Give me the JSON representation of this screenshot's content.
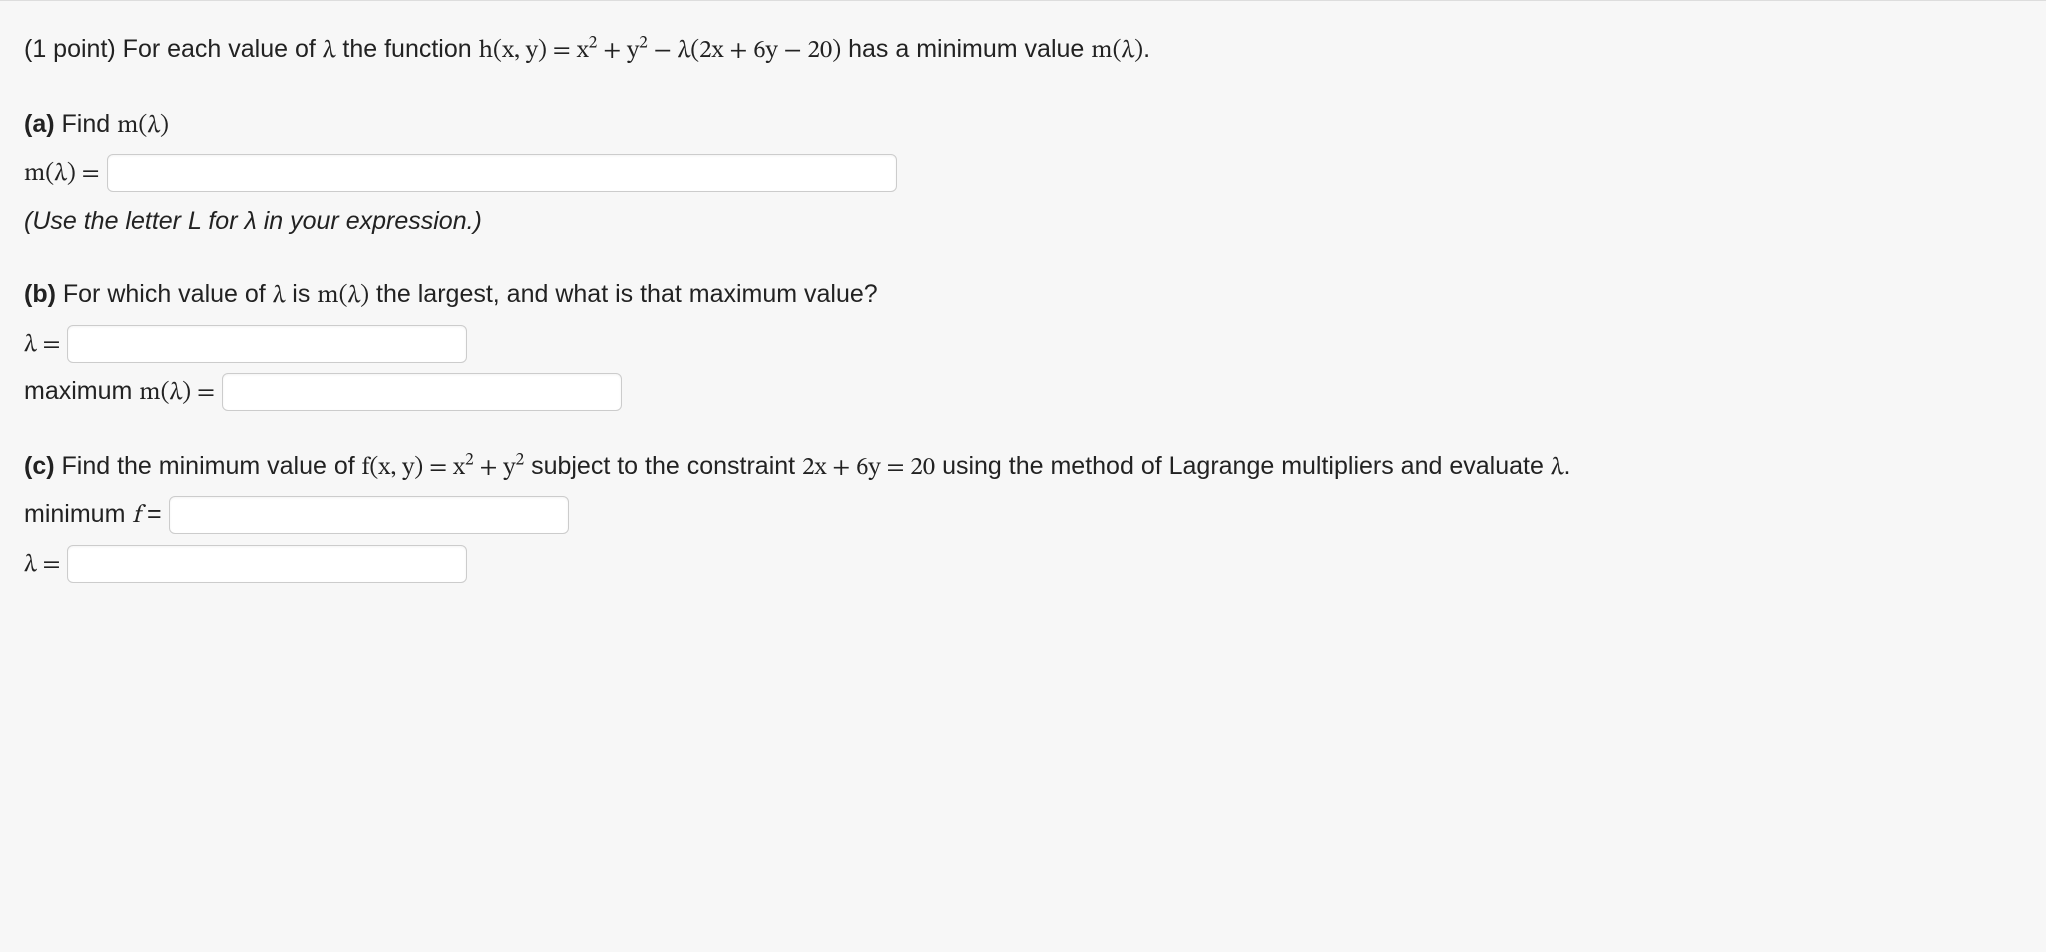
{
  "intro": {
    "points_prefix": "(1 point) ",
    "lead_text": "For each value of ",
    "lambda": "λ",
    "mid_text": " the function ",
    "func_lhs": "h(x, y) = ",
    "func_rhs_a": "x",
    "func_rhs_b": " + y",
    "func_rhs_c": " − λ(2x + 6y − 20)",
    "tail_text": " has a minimum value ",
    "m_lambda": "m(λ)",
    "period": "."
  },
  "partA": {
    "label": "(a)",
    "prompt": " Find ",
    "m_lambda": "m(λ)",
    "equals_label": "m(λ) =",
    "hint": "(Use the letter L for λ in your expression.)"
  },
  "partB": {
    "label": "(b)",
    "prompt_1": " For which value of ",
    "lambda": "λ",
    "prompt_2": " is ",
    "m_lambda": "m(λ)",
    "prompt_3": " the largest, and what is that maximum value?",
    "lambda_equals": "λ =",
    "max_label_prefix": "maximum ",
    "max_label_m": "m(λ) ="
  },
  "partC": {
    "label": "(c)",
    "prompt_1": " Find the minimum value of ",
    "func_lhs": "f(x, y) = x",
    "plus_y": " + y",
    "prompt_2": " subject to the constraint ",
    "constraint": "2x + 6y = 20",
    "prompt_3": " using the method of Lagrange multipliers and evaluate ",
    "lambda": "λ",
    "period": ".",
    "min_label_prefix": "minimum ",
    "min_label_f": "f",
    "equals_text": " = ",
    "lambda_equals": "λ ="
  }
}
